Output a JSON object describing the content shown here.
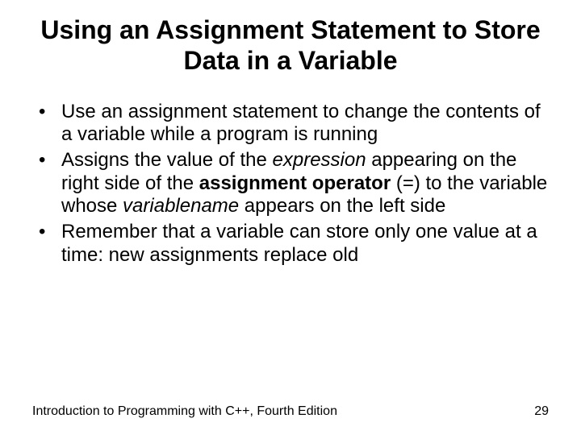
{
  "title": "Using an Assignment Statement to Store Data in a Variable",
  "bullets": {
    "b1": "Use an assignment statement to change the contents of a variable while a program is running",
    "b2_p1": "Assigns the value of the ",
    "b2_i1": "expression",
    "b2_p2": " appearing on the right side of the ",
    "b2_b1": "assignment operator",
    "b2_p3": " (=) to the variable whose ",
    "b2_i2": "variablename",
    "b2_p4": " appears on the left side",
    "b3": "Remember that a variable can store only one value at a time: new assignments replace old"
  },
  "footer": {
    "left": "Introduction to Programming with C++, Fourth Edition",
    "page": "29"
  }
}
